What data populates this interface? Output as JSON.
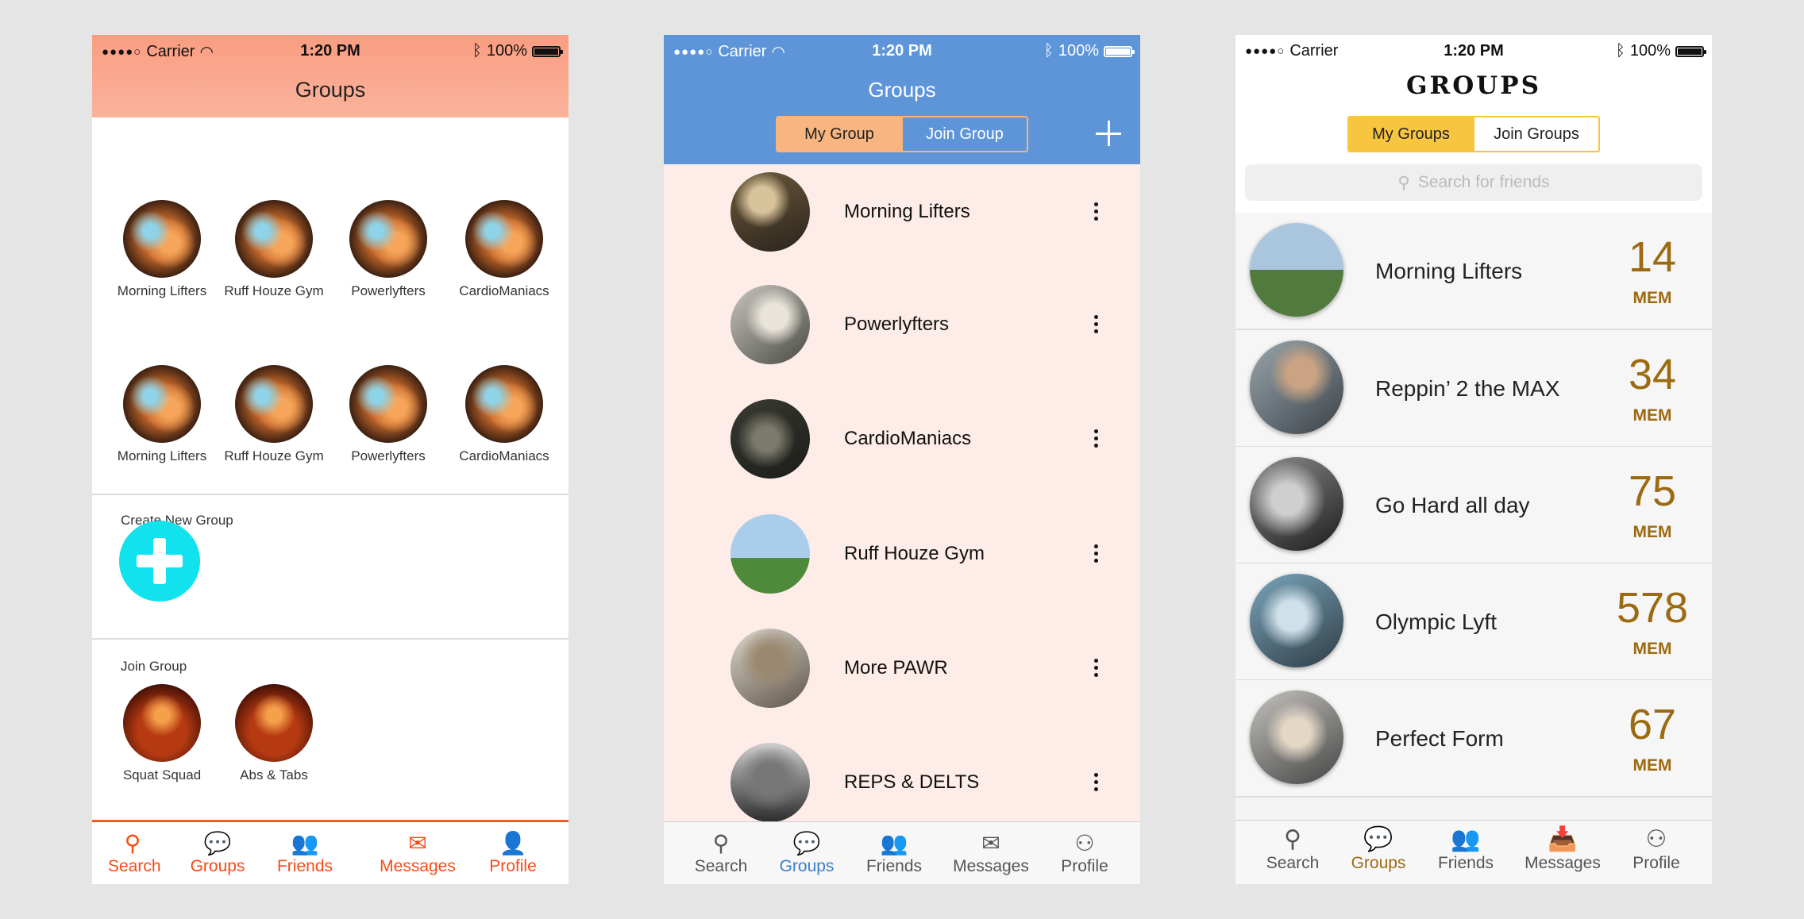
{
  "status": {
    "carrier": "Carrier",
    "time": "1:20 PM",
    "battery": "100%"
  },
  "screen1": {
    "title": "Groups",
    "my_groups": [
      {
        "name": "Morning Lifters"
      },
      {
        "name": "Ruff Houze Gym"
      },
      {
        "name": "Powerlyfters"
      },
      {
        "name": "CardioManiacs"
      },
      {
        "name": "Morning Lifters"
      },
      {
        "name": "Ruff Houze Gym"
      },
      {
        "name": "Powerlyfters"
      },
      {
        "name": "CardioManiacs"
      }
    ],
    "create_label": "Create New Group",
    "join_label": "Join Group",
    "join_groups": [
      {
        "name": "Squat Squad"
      },
      {
        "name": "Abs & Tabs"
      }
    ],
    "tabs": [
      {
        "label": "Search",
        "icon": "search-icon"
      },
      {
        "label": "Groups",
        "icon": "chat-bubbles-icon"
      },
      {
        "label": "Friends",
        "icon": "people-icon"
      },
      {
        "label": "Messages",
        "icon": "envelope-icon"
      },
      {
        "label": "Profile",
        "icon": "person-icon"
      }
    ],
    "colors": {
      "accent": "#fa4a14",
      "header": "#f99d81",
      "plus": "#12e2ee"
    }
  },
  "screen2": {
    "title": "Groups",
    "segments": [
      "My Group",
      "Join Group"
    ],
    "groups": [
      {
        "name": "Morning Lifters"
      },
      {
        "name": "Powerlyfters"
      },
      {
        "name": "CardioManiacs"
      },
      {
        "name": "Ruff Houze Gym"
      },
      {
        "name": "More PAWR"
      },
      {
        "name": "REPS & DELTS"
      }
    ],
    "tabs": [
      {
        "label": "Search",
        "icon": "search-icon"
      },
      {
        "label": "Groups",
        "icon": "chat-bubbles-icon"
      },
      {
        "label": "Friends",
        "icon": "people-icon"
      },
      {
        "label": "Messages",
        "icon": "envelope-icon"
      },
      {
        "label": "Profile",
        "icon": "person-icon"
      }
    ],
    "active_tab": "Groups",
    "colors": {
      "header": "#5d95d8",
      "segment": "#f8b57f",
      "list_bg": "#fdece8",
      "active": "#3a7fd0"
    }
  },
  "screen3": {
    "title": "GROUPS",
    "segments": [
      "My Groups",
      "Join Groups"
    ],
    "search_placeholder": "Search for friends",
    "groups": [
      {
        "name": "Morning Lifters",
        "count": "14",
        "unit": "MEM"
      },
      {
        "name": "Reppin’ 2 the MAX",
        "count": "34",
        "unit": "MEM"
      },
      {
        "name": "Go Hard all day",
        "count": "75",
        "unit": "MEM"
      },
      {
        "name": "Olympic Lyft",
        "count": "578",
        "unit": "MEM"
      },
      {
        "name": "Perfect Form",
        "count": "67",
        "unit": "MEM"
      }
    ],
    "tabs": [
      {
        "label": "Search",
        "icon": "search-icon"
      },
      {
        "label": "Groups",
        "icon": "chat-bubbles-icon"
      },
      {
        "label": "Friends",
        "icon": "people-icon"
      },
      {
        "label": "Messages",
        "icon": "inbox-icon"
      },
      {
        "label": "Profile",
        "icon": "person-icon"
      }
    ],
    "active_tab": "Groups",
    "colors": {
      "segment": "#f8c541",
      "accent": "#9b6a11"
    }
  }
}
